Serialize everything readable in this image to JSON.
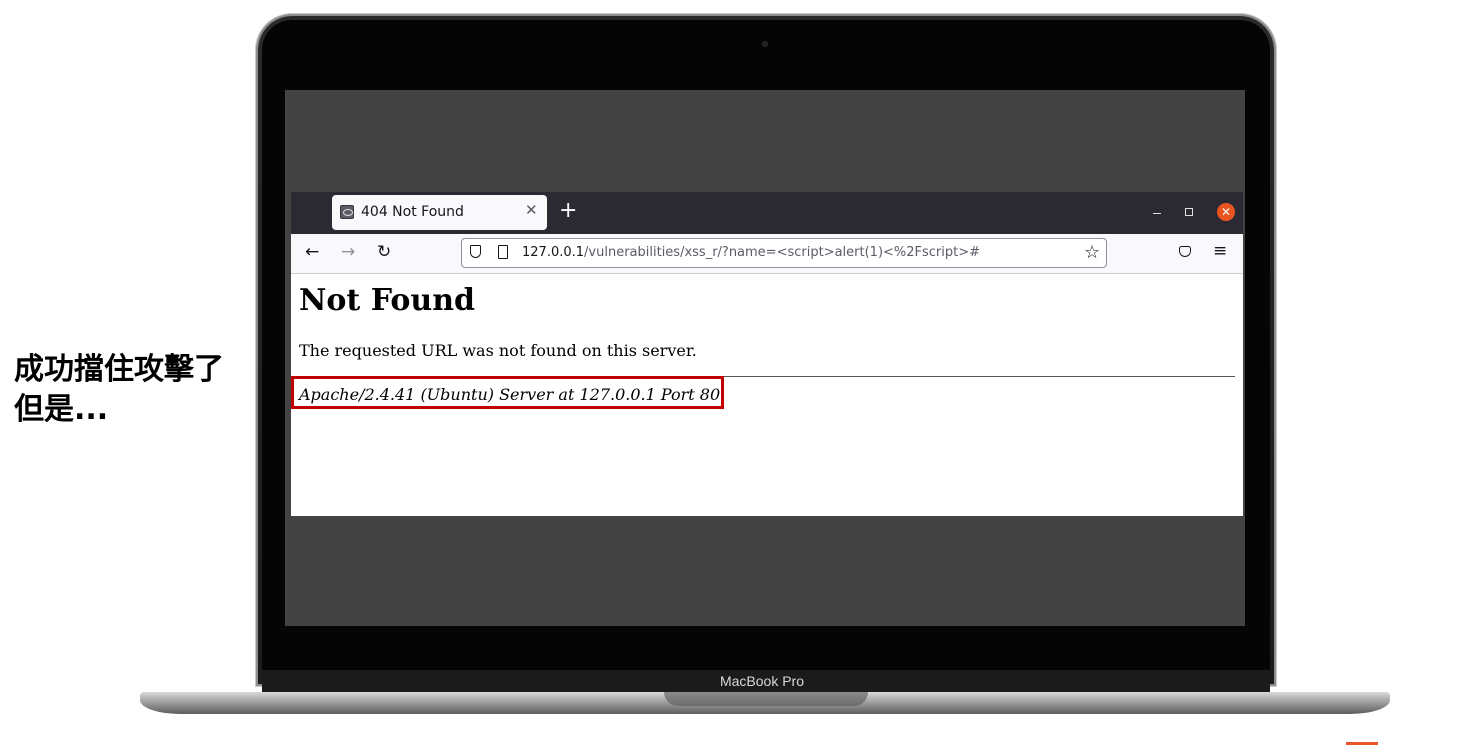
{
  "caption": {
    "line1": "成功擋住攻擊了",
    "line2": "但是..."
  },
  "device": {
    "label": "MacBook Pro"
  },
  "browser": {
    "tab": {
      "title": "404 Not Found",
      "close_icon": "close-icon",
      "favicon": "page-favicon-icon"
    },
    "new_tab_label": "+",
    "window_controls": {
      "minimize": "–",
      "maximize": "□",
      "close": "✕"
    },
    "nav": {
      "back": "←",
      "forward": "→",
      "reload": "C"
    },
    "url": {
      "host": "127.0.0.1",
      "path": "/vulnerabilities/xss_r/?name=<script>alert(1)<%2Fscript>#"
    },
    "bookmark_star": "☆",
    "menu": "≡"
  },
  "page": {
    "heading": "Not Found",
    "message": "The requested URL was not found on this server.",
    "server_signature": "Apache/2.4.41 (Ubuntu) Server at 127.0.0.1 Port 80"
  },
  "colors": {
    "highlight_border": "#c00000",
    "window_close": "#e95420",
    "tabbar_bg": "#2b2a33"
  }
}
